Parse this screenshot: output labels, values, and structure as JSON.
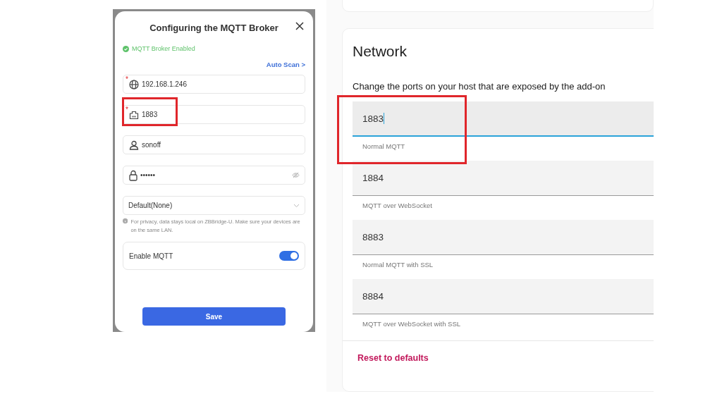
{
  "dialog": {
    "title": "Configuring the MQTT Broker",
    "status": "MQTT Broker Enabled",
    "auto_scan": "Auto Scan >",
    "fields": [
      {
        "kind": "address",
        "value": "192.168.1.246",
        "required_mark": "*"
      },
      {
        "kind": "port",
        "value": "1883",
        "required_mark": "*"
      },
      {
        "kind": "user",
        "value": "sonoff"
      },
      {
        "kind": "password",
        "value": "••••••"
      },
      {
        "kind": "select",
        "value": "Default(None)"
      }
    ],
    "note": "For privacy, data stays local on ZBBridge-U. Make sure your devices are on the same LAN.",
    "toggle": {
      "label": "Enable MQTT",
      "on": true
    },
    "save": "Save"
  },
  "network": {
    "title": "Network",
    "description": "Change the ports on your host that are exposed by the add-on",
    "ports": [
      {
        "value": "1883",
        "label": "Normal MQTT",
        "focused": true
      },
      {
        "value": "1884",
        "label": "MQTT over WebSocket",
        "focused": false
      },
      {
        "value": "8883",
        "label": "Normal MQTT with SSL",
        "focused": false
      },
      {
        "value": "8884",
        "label": "MQTT over WebSocket with SSL",
        "focused": false
      }
    ],
    "reset": "Reset to defaults"
  }
}
